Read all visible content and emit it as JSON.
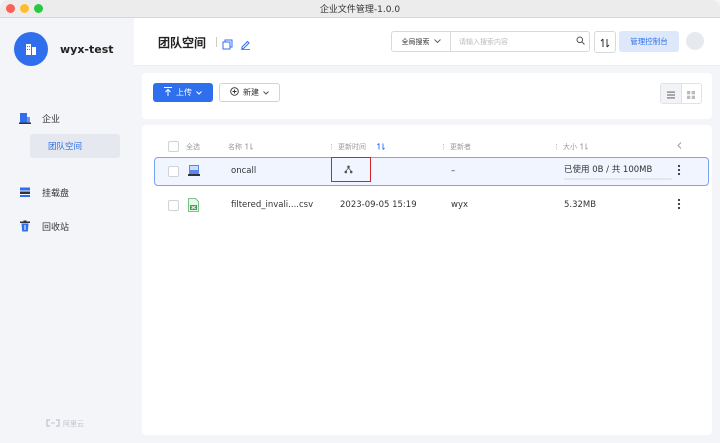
{
  "window": {
    "title": "企业文件管理-1.0.0"
  },
  "sidebar": {
    "org_name": "wyx-test",
    "items": [
      {
        "label": "企业",
        "icon": "enterprise-icon"
      },
      {
        "label": "团队空间",
        "icon": ""
      },
      {
        "label": "挂载盘",
        "icon": "mount-disk-icon"
      },
      {
        "label": "回收站",
        "icon": "trash-icon"
      }
    ],
    "footer_brand": "阿里云"
  },
  "header": {
    "title": "团队空间",
    "search_scope": "全局搜索",
    "search_placeholder": "请输入搜索内容",
    "admin_button": "管理控制台"
  },
  "toolbar": {
    "upload_label": "上传",
    "new_label": "新建"
  },
  "table": {
    "columns": {
      "select_all": "全选",
      "name": "名称",
      "updated_time": "更新时间",
      "updater": "更新者",
      "size": "大小"
    },
    "rows": [
      {
        "name": "oncall",
        "updated_time": "",
        "updater": "–",
        "size": "已使用 0B / 共 100MB",
        "type": "team-folder",
        "usage_fraction": 0.0,
        "selected": true
      },
      {
        "name": "filtered_invali....csv",
        "updated_time": "2023-09-05 15:19",
        "updater": "wyx",
        "size": "5.32MB",
        "type": "csv-file",
        "selected": false
      }
    ]
  },
  "colors": {
    "accent": "#2f6fed",
    "highlight_box": "#d0262a",
    "selected_row_border": "#7aa4ee"
  }
}
